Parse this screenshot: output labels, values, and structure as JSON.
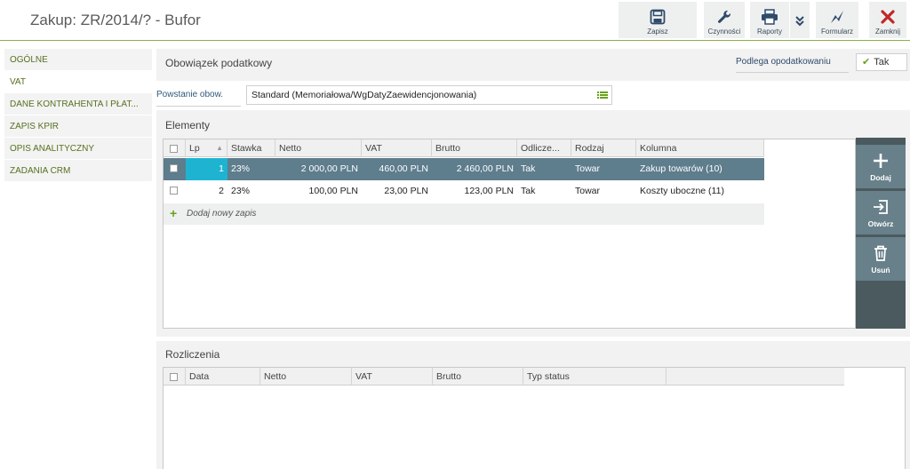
{
  "window": {
    "title": "Zakup: ZR/2014/? - Bufor"
  },
  "toolbar": {
    "save": "Zapisz",
    "actions": "Czynności",
    "reports": "Raporty",
    "form": "Formularz",
    "close": "Zamknij"
  },
  "nav": {
    "items": [
      {
        "label": "OGÓLNE"
      },
      {
        "label": "VAT"
      },
      {
        "label": "DANE KONTRAHENTA I PŁAT..."
      },
      {
        "label": "ZAPIS KPIR"
      },
      {
        "label": "OPIS ANALITYCZNY"
      },
      {
        "label": "ZADANIA CRM"
      }
    ]
  },
  "tax": {
    "title": "Obowiązek podatkowy",
    "subject_label": "Podlega opodatkowaniu",
    "subject_value": "Tak",
    "origin_label": "Powstanie obow.",
    "origin_value": "Standard (Memoriałowa/WgDatyZaewidencjonowania)"
  },
  "elements": {
    "title": "Elementy",
    "columns": {
      "lp": "Lp",
      "rate": "Stawka",
      "net": "Netto",
      "vat": "VAT",
      "gross": "Brutto",
      "deduct": "Odlicze...",
      "kind": "Rodzaj",
      "column": "Kolumna"
    },
    "rows": [
      {
        "lp": "1",
        "rate": "23%",
        "net": "2 000,00 PLN",
        "vat": "460,00 PLN",
        "gross": "2 460,00 PLN",
        "deduct": "Tak",
        "kind": "Towar",
        "column": "Zakup towarów (10)"
      },
      {
        "lp": "2",
        "rate": "23%",
        "net": "100,00 PLN",
        "vat": "23,00 PLN",
        "gross": "123,00 PLN",
        "deduct": "Tak",
        "kind": "Towar",
        "column": "Koszty uboczne (11)"
      }
    ],
    "add_new": "Dodaj nowy zapis",
    "side": {
      "add": "Dodaj",
      "open": "Otwórz",
      "delete": "Usuń"
    }
  },
  "settlements": {
    "title": "Rozliczenia",
    "columns": {
      "date": "Data",
      "net": "Netto",
      "vat": "VAT",
      "gross": "Brutto",
      "status": "Typ status"
    }
  },
  "colors": {
    "accent_green": "#6aa21e",
    "selected_row": "#5e7d8d",
    "selected_cell": "#1fb3d2",
    "close_red": "#c0282a"
  }
}
